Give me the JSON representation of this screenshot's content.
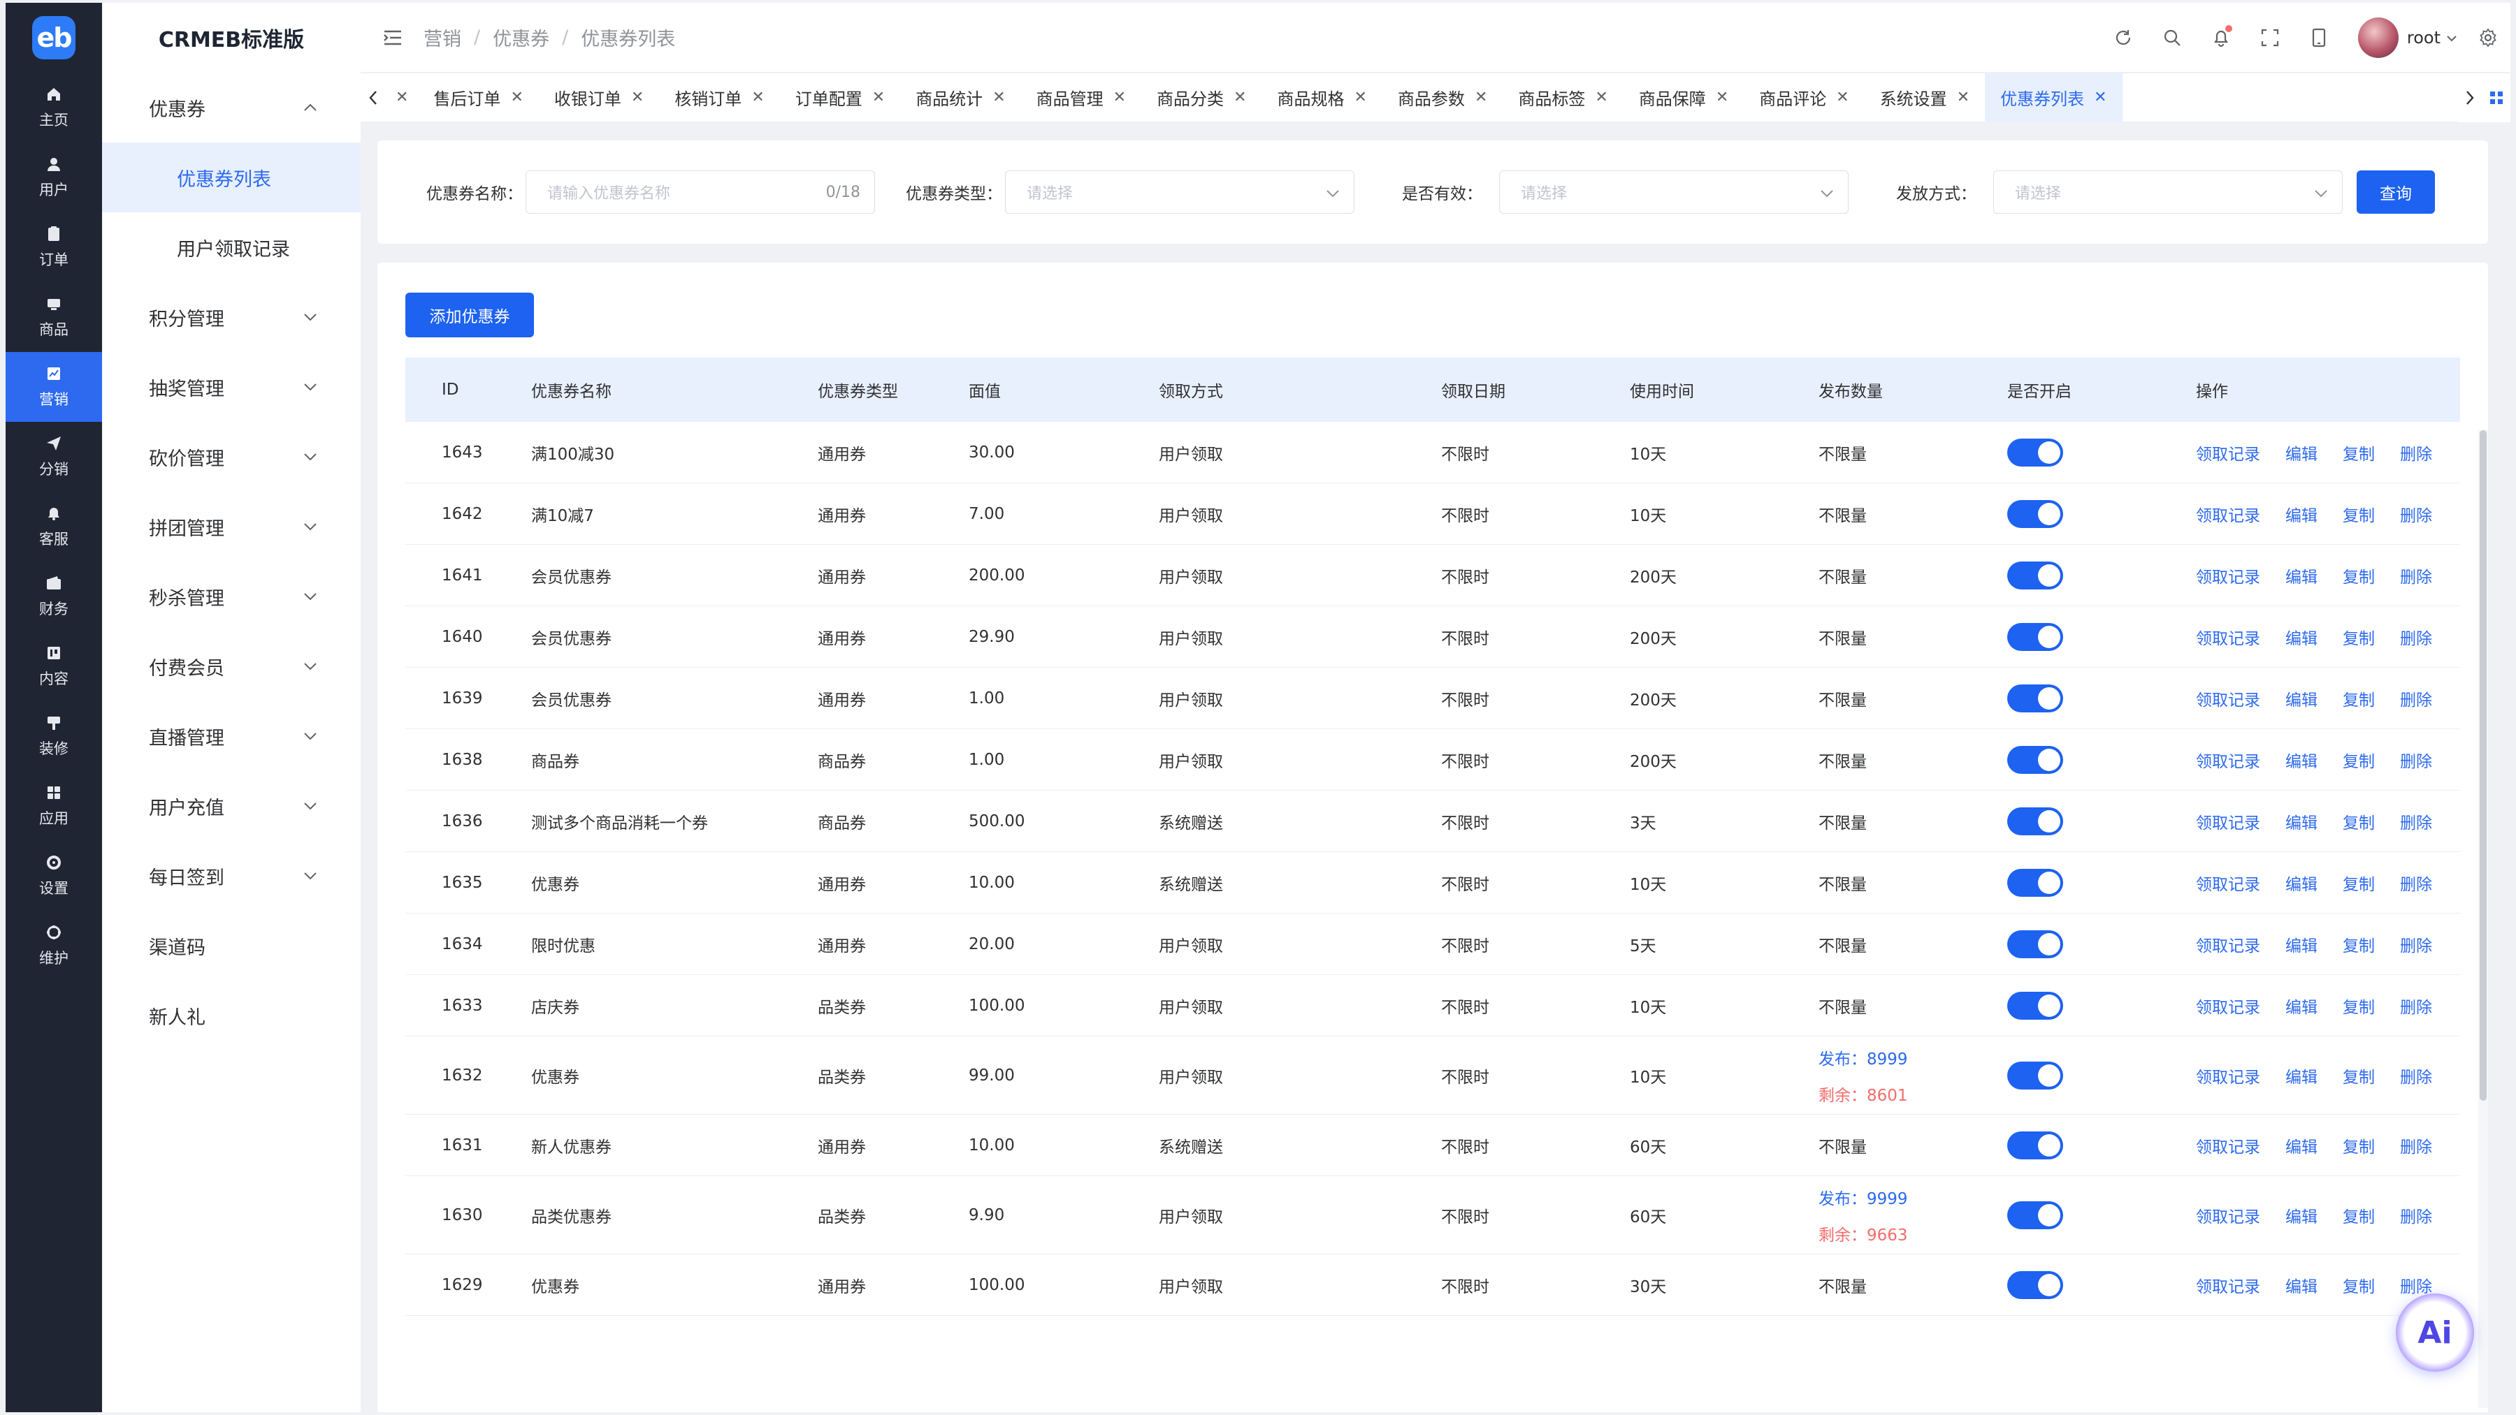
{
  "app": {
    "logo_text": "eb",
    "brand": "CRMEB标准版"
  },
  "rail": [
    {
      "label": "主页",
      "icon": "home-icon"
    },
    {
      "label": "用户",
      "icon": "user-icon"
    },
    {
      "label": "订单",
      "icon": "order-icon"
    },
    {
      "label": "商品",
      "icon": "product-icon"
    },
    {
      "label": "营销",
      "icon": "marketing-icon",
      "active": true
    },
    {
      "label": "分销",
      "icon": "send-icon"
    },
    {
      "label": "客服",
      "icon": "bell-icon"
    },
    {
      "label": "财务",
      "icon": "wallet-icon"
    },
    {
      "label": "内容",
      "icon": "content-icon"
    },
    {
      "label": "装修",
      "icon": "decorate-icon"
    },
    {
      "label": "应用",
      "icon": "apps-icon"
    },
    {
      "label": "设置",
      "icon": "settings-icon"
    },
    {
      "label": "维护",
      "icon": "maintenance-icon"
    }
  ],
  "submenu": {
    "group_open": "优惠券",
    "children": [
      "优惠券列表",
      "用户领取记录"
    ],
    "groups": [
      "积分管理",
      "抽奖管理",
      "砍价管理",
      "拼团管理",
      "秒杀管理",
      "付费会员",
      "直播管理",
      "用户充值",
      "每日签到"
    ],
    "plain": [
      "渠道码",
      "新人礼"
    ]
  },
  "breadcrumb": [
    "营销",
    "优惠券",
    "优惠券列表"
  ],
  "header": {
    "user": "root",
    "icons": [
      "refresh-icon",
      "search-icon",
      "bell-icon",
      "fullscreen-icon",
      "tablet-icon"
    ]
  },
  "tabs": [
    "售后订单",
    "收银订单",
    "核销订单",
    "订单配置",
    "商品统计",
    "商品管理",
    "商品分类",
    "商品规格",
    "商品参数",
    "商品标签",
    "商品保障",
    "商品评论",
    "系统设置",
    "优惠券列表"
  ],
  "filter": {
    "name_label": "优惠券名称：",
    "name_placeholder": "请输入优惠券名称",
    "name_count": "0/18",
    "type_label": "优惠券类型：",
    "type_placeholder": "请选择",
    "valid_label": "是否有效：",
    "valid_placeholder": "请选择",
    "method_label": "发放方式：",
    "method_placeholder": "请选择",
    "search_button": "查询"
  },
  "add_button": "添加优惠券",
  "table": {
    "headers": [
      "ID",
      "优惠券名称",
      "优惠券类型",
      "面值",
      "领取方式",
      "领取日期",
      "使用时间",
      "发布数量",
      "是否开启",
      "操作"
    ],
    "ops": [
      "领取记录",
      "编辑",
      "复制",
      "删除"
    ],
    "rows": [
      {
        "id": "1643",
        "name": "满100减30",
        "type": "通用券",
        "value": "30.00",
        "method": "用户领取",
        "date": "不限时",
        "use": "10天",
        "qty": "不限量",
        "enabled": true
      },
      {
        "id": "1642",
        "name": "满10减7",
        "type": "通用券",
        "value": "7.00",
        "method": "用户领取",
        "date": "不限时",
        "use": "10天",
        "qty": "不限量",
        "enabled": true
      },
      {
        "id": "1641",
        "name": "会员优惠券",
        "type": "通用券",
        "value": "200.00",
        "method": "用户领取",
        "date": "不限时",
        "use": "200天",
        "qty": "不限量",
        "enabled": true
      },
      {
        "id": "1640",
        "name": "会员优惠券",
        "type": "通用券",
        "value": "29.90",
        "method": "用户领取",
        "date": "不限时",
        "use": "200天",
        "qty": "不限量",
        "enabled": true
      },
      {
        "id": "1639",
        "name": "会员优惠券",
        "type": "通用券",
        "value": "1.00",
        "method": "用户领取",
        "date": "不限时",
        "use": "200天",
        "qty": "不限量",
        "enabled": true
      },
      {
        "id": "1638",
        "name": "商品券",
        "type": "商品券",
        "value": "1.00",
        "method": "用户领取",
        "date": "不限时",
        "use": "200天",
        "qty": "不限量",
        "enabled": true
      },
      {
        "id": "1636",
        "name": "测试多个商品消耗一个券",
        "type": "商品券",
        "value": "500.00",
        "method": "系统赠送",
        "date": "不限时",
        "use": "3天",
        "qty": "不限量",
        "enabled": true
      },
      {
        "id": "1635",
        "name": "优惠券",
        "type": "通用券",
        "value": "10.00",
        "method": "系统赠送",
        "date": "不限时",
        "use": "10天",
        "qty": "不限量",
        "enabled": true
      },
      {
        "id": "1634",
        "name": "限时优惠",
        "type": "通用券",
        "value": "20.00",
        "method": "用户领取",
        "date": "不限时",
        "use": "5天",
        "qty": "不限量",
        "enabled": true
      },
      {
        "id": "1633",
        "name": "店庆券",
        "type": "品类券",
        "value": "100.00",
        "method": "用户领取",
        "date": "不限时",
        "use": "10天",
        "qty": "不限量",
        "enabled": true
      },
      {
        "id": "1632",
        "name": "优惠券",
        "type": "品类券",
        "value": "99.00",
        "method": "用户领取",
        "date": "不限时",
        "use": "10天",
        "qty_pub": "发布：8999",
        "qty_rem": "剩余：8601",
        "enabled": true
      },
      {
        "id": "1631",
        "name": "新人优惠券",
        "type": "通用券",
        "value": "10.00",
        "method": "系统赠送",
        "date": "不限时",
        "use": "60天",
        "qty": "不限量",
        "enabled": true
      },
      {
        "id": "1630",
        "name": "品类优惠券",
        "type": "品类券",
        "value": "9.90",
        "method": "用户领取",
        "date": "不限时",
        "use": "60天",
        "qty_pub": "发布：9999",
        "qty_rem": "剩余：9663",
        "enabled": true
      },
      {
        "id": "1629",
        "name": "优惠券",
        "type": "通用券",
        "value": "100.00",
        "method": "用户领取",
        "date": "不限时",
        "use": "30天",
        "qty": "不限量",
        "enabled": true
      }
    ]
  },
  "ai_label": "Ai"
}
